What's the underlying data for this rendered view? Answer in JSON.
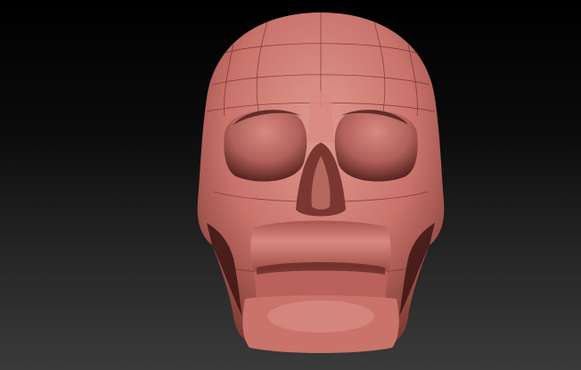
{
  "colors": {
    "background_top": "#000000",
    "background_bottom": "#3a3a3a",
    "skin": "#c9736b",
    "skin_highlight": "#e09a90",
    "shadow": "#5a2420",
    "wire": "#6b2a25"
  }
}
